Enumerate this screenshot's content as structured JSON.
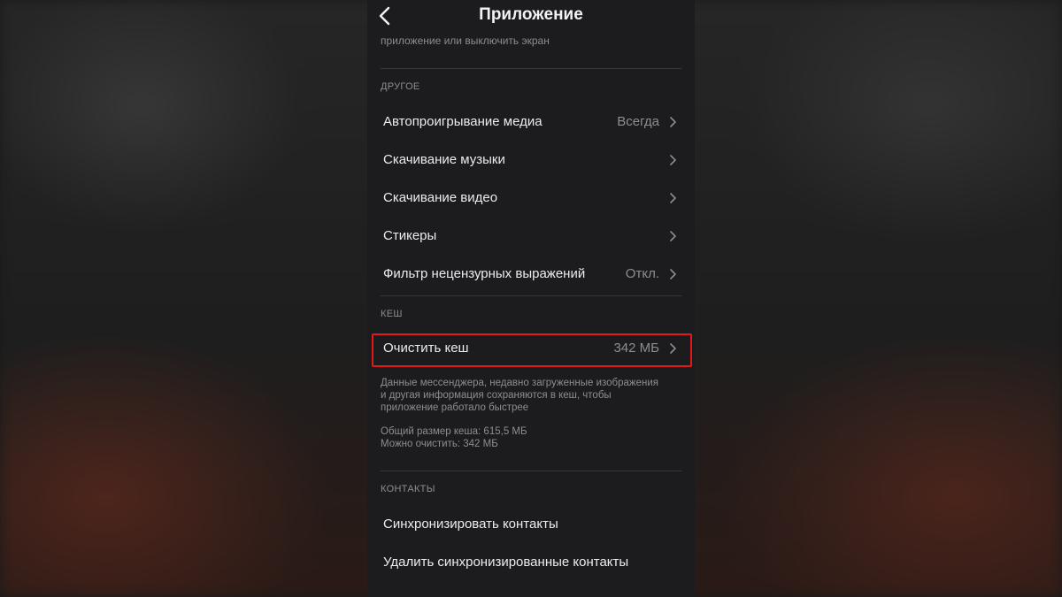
{
  "header": {
    "title": "Приложение",
    "back_icon": "chevron-left-icon"
  },
  "top_description": "приложение или выключить экран",
  "sections": {
    "other": {
      "header": "ДРУГОЕ",
      "items": [
        {
          "label": "Автопроигрывание медиа",
          "value": "Всегда"
        },
        {
          "label": "Скачивание музыки",
          "value": ""
        },
        {
          "label": "Скачивание видео",
          "value": ""
        },
        {
          "label": "Стикеры",
          "value": ""
        },
        {
          "label": "Фильтр нецензурных выражений",
          "value": "Откл."
        }
      ]
    },
    "cache": {
      "header": "КЕШ",
      "clear_label": "Очистить кеш",
      "clear_value": "342 МБ",
      "description": [
        "Данные мессенджера, недавно загруженные изображения",
        "и другая информация сохраняются в кеш, чтобы",
        "приложение работало быстрее"
      ],
      "stats": [
        "Общий размер кеша: 615,5 МБ",
        "Можно очистить: 342 МБ"
      ]
    },
    "contacts": {
      "header": "КОНТАКТЫ",
      "items": [
        {
          "label": "Синхронизировать контакты"
        },
        {
          "label": "Удалить синхронизированные контакты"
        }
      ]
    }
  },
  "colors": {
    "highlight": "#e01a1a",
    "background": "#1c1c1e",
    "text_primary": "#ececec",
    "text_secondary": "#8d8d92"
  }
}
